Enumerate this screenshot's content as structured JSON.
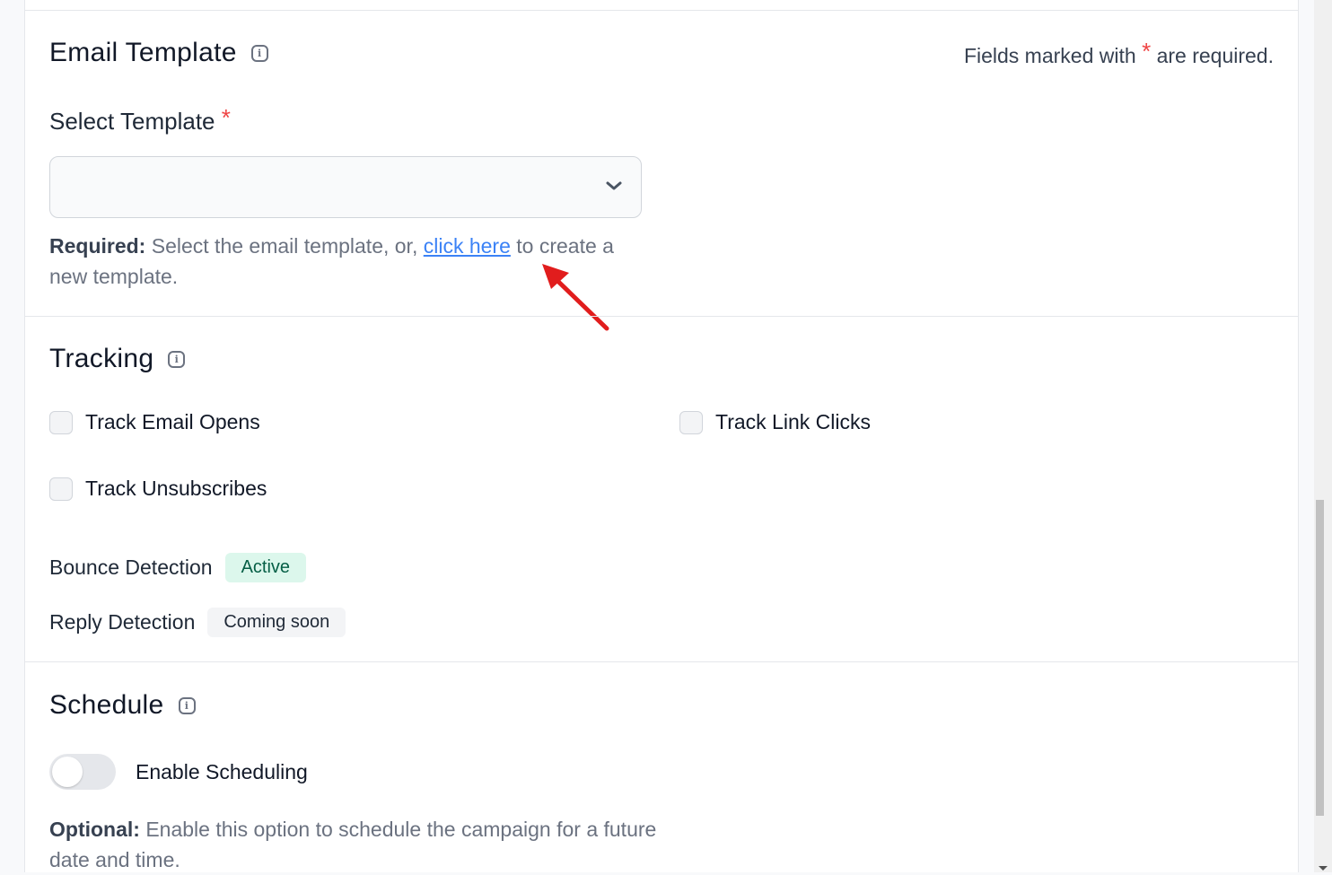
{
  "email_template": {
    "title": "Email Template",
    "required_note_prefix": "Fields marked with",
    "required_star": "*",
    "required_note_suffix": "are required.",
    "select_label": "Select Template",
    "select_value": "",
    "help_bold": "Required:",
    "help_text_1": "Select the email template, or,",
    "help_link": "click here",
    "help_text_2": "to create a new template."
  },
  "tracking": {
    "title": "Tracking",
    "checkboxes": [
      {
        "label": "Track Email Opens",
        "checked": false
      },
      {
        "label": "Track Link Clicks",
        "checked": false
      },
      {
        "label": "Track Unsubscribes",
        "checked": false
      }
    ],
    "bounce_label": "Bounce Detection",
    "bounce_status": "Active",
    "reply_label": "Reply Detection",
    "reply_status": "Coming soon",
    "colors": {
      "active_bg": "#dcf7ec",
      "active_text": "#065f46",
      "link": "#3b82f6",
      "required": "#ef4444"
    }
  },
  "schedule": {
    "title": "Schedule",
    "toggle_label": "Enable Scheduling",
    "toggle_on": false,
    "help_bold": "Optional:",
    "help_text": "Enable this option to schedule the campaign for a future date and time."
  }
}
